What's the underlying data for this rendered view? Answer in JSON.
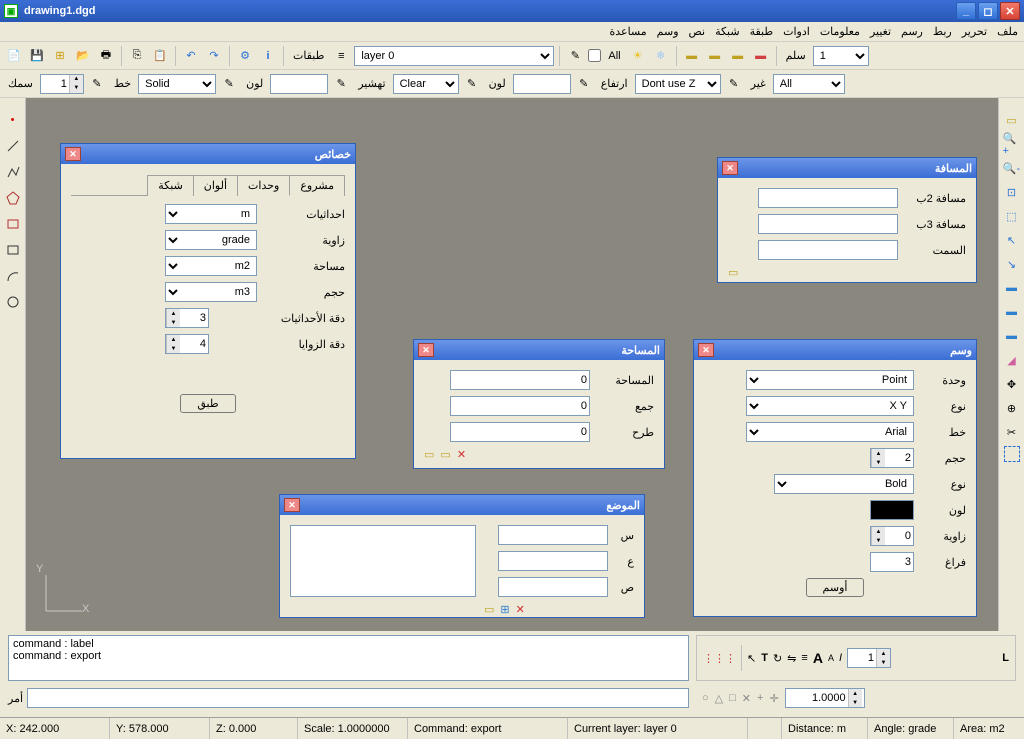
{
  "window": {
    "title": "drawing1.dgd"
  },
  "menu": [
    "ملف",
    "تحرير",
    "ربط",
    "رسم",
    "تغيير",
    "معلومات",
    "ادوات",
    "طبقة",
    "شبكة",
    "نص",
    "وسم",
    "مساعدة"
  ],
  "toolbar1": {
    "layers_label": "طبقات",
    "layer_select": "layer 0",
    "all_label": "All",
    "scale_label": "سلم",
    "scale_value": "1"
  },
  "toolbar2": {
    "thickness_label": "سمك",
    "thickness_value": "1",
    "line_label": "خط",
    "line_style": "Solid",
    "color_label": "لون",
    "hatch_label": "تهشير",
    "hatch_value": "Clear",
    "color2_label": "لون",
    "height_label": "ارتفاع",
    "z_value": "Dont use Z",
    "other_label": "غير",
    "filter_value": "All"
  },
  "panels": {
    "properties": {
      "title": "خصائص",
      "tabs": [
        "مشروع",
        "وحدات",
        "ألوان",
        "شبكة"
      ],
      "active_tab": 1,
      "rows": {
        "coords": {
          "label": "احداثيات",
          "value": "m"
        },
        "angle": {
          "label": "زاوية",
          "value": "grade"
        },
        "area": {
          "label": "مساحة",
          "value": "m2"
        },
        "volume": {
          "label": "حجم",
          "value": "m3"
        },
        "coord_prec": {
          "label": "دقة الأحداثيات",
          "value": "3"
        },
        "angle_prec": {
          "label": "دقة الزوايا",
          "value": "4"
        }
      },
      "apply": "طبق"
    },
    "distance": {
      "title": "المسافة",
      "rows": {
        "d2": {
          "label": "مسافة 2ب",
          "value": ""
        },
        "d3": {
          "label": "مسافة 3ب",
          "value": ""
        },
        "azimuth": {
          "label": "السمت",
          "value": ""
        }
      }
    },
    "area": {
      "title": "المساحة",
      "rows": {
        "area": {
          "label": "المساحة",
          "value": "0"
        },
        "sum": {
          "label": "جمع",
          "value": "0"
        },
        "sub": {
          "label": "طرح",
          "value": "0"
        }
      }
    },
    "label_panel": {
      "title": "وسم",
      "rows": {
        "unit": {
          "label": "وحدة",
          "value": "Point"
        },
        "type1": {
          "label": "نوع",
          "value": "X Y"
        },
        "font": {
          "label": "خط",
          "value": "Arial"
        },
        "size": {
          "label": "حجم",
          "value": "2"
        },
        "type2": {
          "label": "نوع",
          "value": "Bold"
        },
        "color": {
          "label": "لون",
          "value": ""
        },
        "angle": {
          "label": "زاوية",
          "value": "0"
        },
        "gap": {
          "label": "فراغ",
          "value": "3"
        }
      },
      "apply": "أوسم"
    },
    "position": {
      "title": "الموضع",
      "rows": {
        "x": {
          "label": "س",
          "value": ""
        },
        "y": {
          "label": "ع",
          "value": ""
        },
        "z": {
          "label": "ص",
          "value": ""
        }
      }
    }
  },
  "axis": {
    "x": "X",
    "y": "Y"
  },
  "command": {
    "log": [
      "command : label",
      "command : export"
    ],
    "prompt": "أمر"
  },
  "format_bar": {
    "size_value": "1"
  },
  "scale_bar": {
    "value": "1.0000"
  },
  "status": {
    "x": "X: 242.000",
    "y": "Y: 578.000",
    "z": "Z: 0.000",
    "scale": "Scale: 1.0000000",
    "command": "Command: export",
    "layer": "Current layer: layer 0",
    "distance": "Distance: m",
    "angle": "Angle: grade",
    "area": "Area: m2"
  }
}
